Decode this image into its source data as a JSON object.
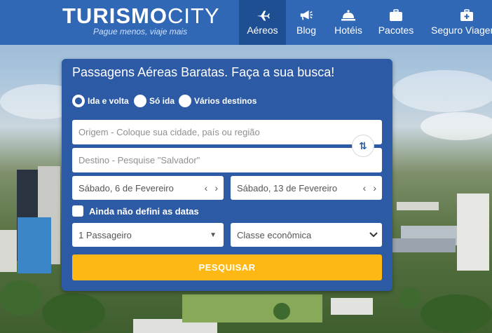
{
  "header": {
    "logo_bold": "TURISMO",
    "logo_light": "CITY",
    "slogan": "Pague menos, viaje mais",
    "nav": [
      {
        "label": "Aéreos",
        "icon": "airplane-icon",
        "active": true
      },
      {
        "label": "Blog",
        "icon": "megaphone-icon",
        "active": false
      },
      {
        "label": "Hotéis",
        "icon": "service-bell-icon",
        "active": false
      },
      {
        "label": "Pacotes",
        "icon": "suitcase-icon",
        "active": false
      },
      {
        "label": "Seguro Viagem",
        "icon": "first-aid-kit-icon",
        "active": false
      }
    ]
  },
  "search": {
    "title": "Passagens Aéreas Baratas. Faça a sua busca!",
    "trip_types": [
      {
        "label": "Ida e volta",
        "selected": true
      },
      {
        "label": "Só ida",
        "selected": false
      },
      {
        "label": "Vários destinos",
        "selected": false
      }
    ],
    "origin_placeholder": "Origem - Coloque sua cidade, país ou região",
    "destination_placeholder": "Destino - Pesquise \"Salvador\"",
    "departure_date": "Sábado, 6 de Fevereiro",
    "return_date": "Sábado, 13 de Fevereiro",
    "undefined_dates_label": "Ainda não defini as datas",
    "passengers": "1 Passageiro",
    "cabin_class": "Classe econômica",
    "submit_label": "PESQUISAR"
  },
  "colors": {
    "header": "#3068b6",
    "nav_active": "#1f4f93",
    "panel": "#2d5aa5",
    "search_button": "#fdb813"
  }
}
